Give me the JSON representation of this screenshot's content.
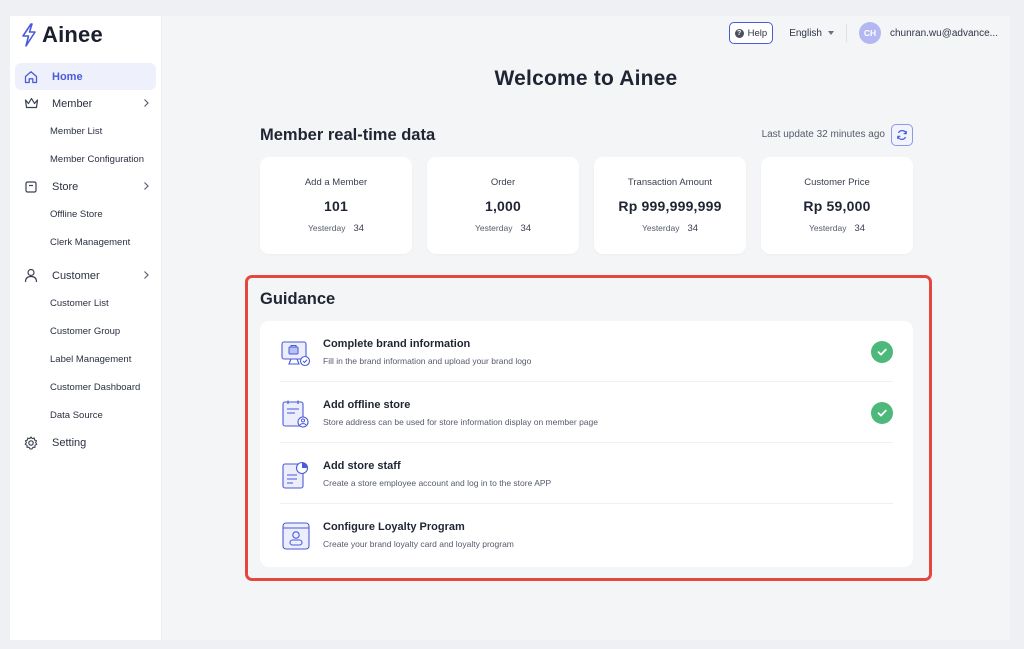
{
  "app": {
    "name": "Ainee"
  },
  "sidebar": {
    "items": [
      {
        "label": "Home",
        "icon": "home-icon",
        "active": true
      },
      {
        "label": "Member",
        "icon": "crown-icon",
        "children": [
          "Member List",
          "Member Configuration"
        ]
      },
      {
        "label": "Store",
        "icon": "store-icon",
        "children": [
          "Offline Store",
          "Clerk Management"
        ]
      },
      {
        "label": "Customer",
        "icon": "user-icon",
        "children": [
          "Customer List",
          "Customer Group",
          "Label Management",
          "Customer Dashboard",
          "Data Source"
        ]
      },
      {
        "label": "Setting",
        "icon": "gear-icon"
      }
    ]
  },
  "topbar": {
    "help_label": "Help",
    "language": "English",
    "avatar_initials": "CH",
    "user_email": "chunran.wu@advance..."
  },
  "main": {
    "welcome_title": "Welcome to Ainee",
    "realtime": {
      "title": "Member real-time data",
      "last_update": "Last update 32 minutes ago",
      "stats": [
        {
          "label": "Add a Member",
          "value": "101",
          "sub_label": "Yesterday",
          "sub_value": "34"
        },
        {
          "label": "Order",
          "value": "1,000",
          "sub_label": "Yesterday",
          "sub_value": "34"
        },
        {
          "label": "Transaction Amount",
          "value": "Rp 999,999,999",
          "sub_label": "Yesterday",
          "sub_value": "34"
        },
        {
          "label": "Customer Price",
          "value": "Rp 59,000",
          "sub_label": "Yesterday",
          "sub_value": "34"
        }
      ]
    },
    "guidance": {
      "title": "Guidance",
      "items": [
        {
          "title": "Complete brand information",
          "desc": "Fill in the brand information and upload your brand logo",
          "done": true,
          "icon": "brand-info-icon"
        },
        {
          "title": "Add offline store",
          "desc": "Store address can be used for store information display on member page",
          "done": true,
          "icon": "offline-store-icon"
        },
        {
          "title": "Add store staff",
          "desc": "Create a store employee account and log in to the store APP",
          "done": false,
          "icon": "store-staff-icon"
        },
        {
          "title": "Configure Loyalty Program",
          "desc": "Create your brand loyalty card and loyalty program",
          "done": false,
          "icon": "loyalty-card-icon"
        }
      ]
    }
  },
  "colors": {
    "accent": "#4a5bd8",
    "success": "#4cb97a",
    "highlight_border": "#e3473e"
  }
}
